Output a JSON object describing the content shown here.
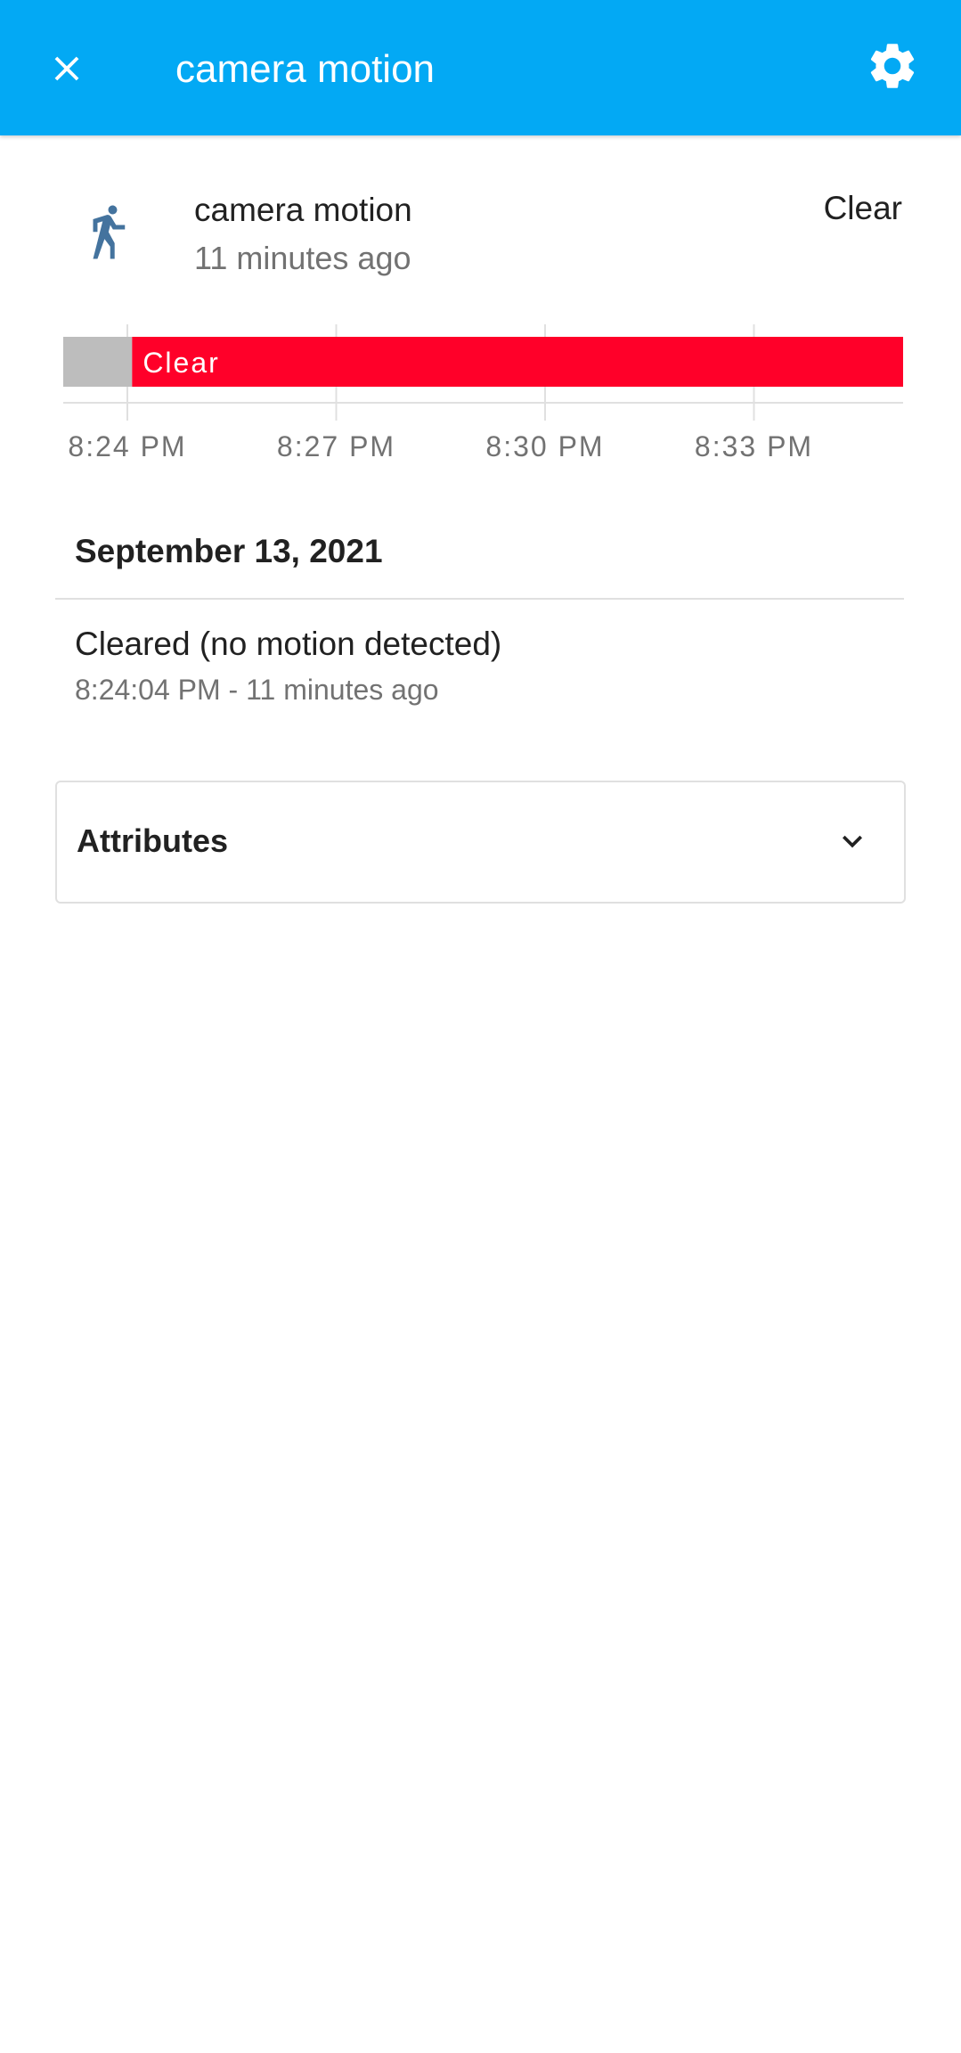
{
  "header": {
    "title": "camera motion",
    "background_color": "#03a9f4",
    "close_icon": "close-icon",
    "settings_icon": "gear-icon"
  },
  "entity": {
    "icon": "walk-icon",
    "name": "camera motion",
    "last_changed": "11 minutes ago",
    "state": "Clear"
  },
  "timeline": {
    "segments": [
      {
        "label": "",
        "color": "#bdbdbd",
        "start_fraction": 0.0,
        "end_fraction": 0.082
      },
      {
        "label": "Clear",
        "color": "#ff0029",
        "start_fraction": 0.082,
        "end_fraction": 1.0
      }
    ],
    "ticks": [
      "8:24 PM",
      "8:27 PM",
      "8:30 PM",
      "8:33 PM"
    ]
  },
  "logbook": {
    "date": "September 13, 2021",
    "entries": [
      {
        "message": "Cleared (no motion detected)",
        "time": "8:24:04 PM - 11 minutes ago"
      }
    ]
  },
  "attributes": {
    "label": "Attributes",
    "chevron_icon": "chevron-down-icon"
  }
}
